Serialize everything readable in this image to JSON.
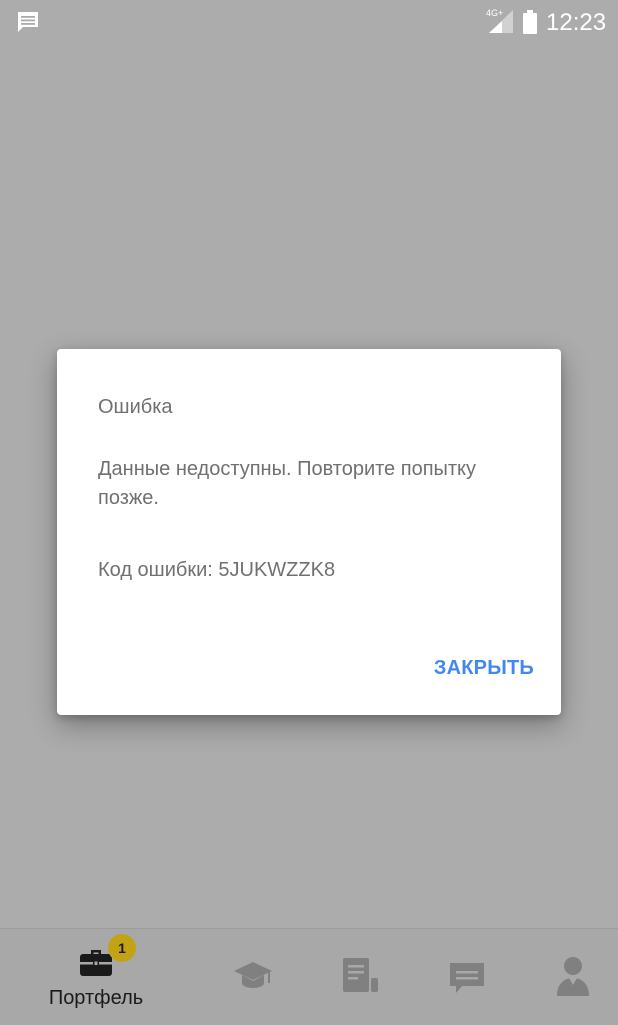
{
  "status_bar": {
    "network": "4G+",
    "time": "12:23"
  },
  "dialog": {
    "title": "Ошибка",
    "message": "Данные недоступны. Повторите попытку позже.",
    "code": "Код ошибки: 5JUKWZZK8",
    "close_label": "ЗАКРЫТЬ"
  },
  "bottom_nav": {
    "items": [
      {
        "icon": "briefcase-icon",
        "label": "Портфель",
        "badge": "1",
        "active": true
      },
      {
        "icon": "graduation-cap-icon",
        "label": "",
        "active": false
      },
      {
        "icon": "document-icon",
        "label": "",
        "active": false
      },
      {
        "icon": "chat-icon",
        "label": "",
        "active": false
      },
      {
        "icon": "profile-icon",
        "label": "",
        "active": false
      }
    ]
  },
  "colors": {
    "accent": "#4189f0",
    "badge": "#c2a316",
    "scrim": "#acacac",
    "inactive_icon": "#808080"
  }
}
